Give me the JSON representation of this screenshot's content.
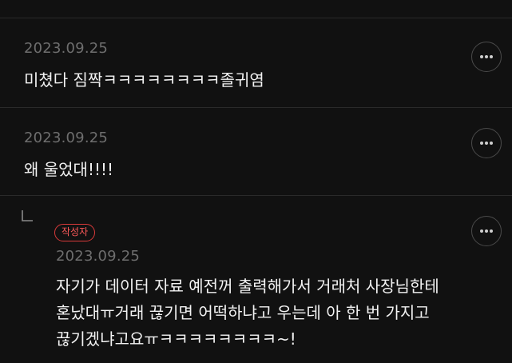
{
  "comments": [
    {
      "date": "2023.09.25",
      "text": "미쳤다 짐짝ㅋㅋㅋㅋㅋㅋㅋㅋ졸귀염"
    },
    {
      "date": "2023.09.25",
      "text": "왜 울었대!!!!"
    }
  ],
  "reply": {
    "badge": "작성자",
    "date": "2023.09.25",
    "lines": [
      "자기가 데이터 자료 예전꺼 출력해가서 거래처 사장님한테",
      "혼났대ㅠ거래 끊기면 어떡하냐고 우는데 아 한 번 가지고",
      "끊기겠냐고요ㅠㅋㅋㅋㅋㅋㅋㅋㅋ~!"
    ]
  },
  "icons": {
    "more": "more-horizontal-icon",
    "reply": "reply-arrow-icon"
  },
  "colors": {
    "background": "#111111",
    "text": "#f2f2f2",
    "date": "#6e6e6e",
    "badge": "#d93a3a",
    "divider": "#2a2a2a"
  }
}
